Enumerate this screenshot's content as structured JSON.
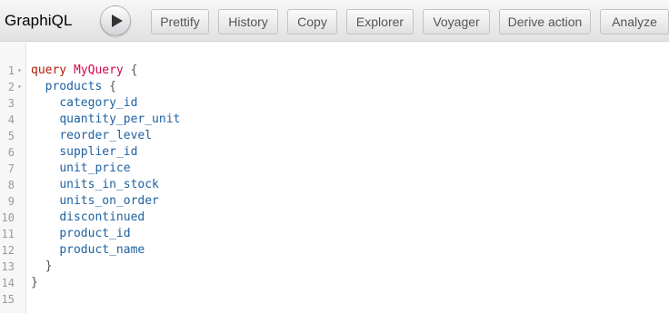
{
  "toolbar": {
    "title": "GraphiQL",
    "buttons": [
      "Prettify",
      "History",
      "Copy",
      "Explorer",
      "Voyager",
      "Derive action",
      "Analyze"
    ]
  },
  "editor": {
    "lines": [
      {
        "num": "1",
        "fold": true,
        "indent": "",
        "tokens": [
          {
            "t": "query",
            "c": "kw"
          },
          {
            "t": " ",
            "c": "punct"
          },
          {
            "t": "MyQuery",
            "c": "def"
          },
          {
            "t": " {",
            "c": "punct"
          }
        ]
      },
      {
        "num": "2",
        "fold": true,
        "indent": "  ",
        "tokens": [
          {
            "t": "products",
            "c": "field"
          },
          {
            "t": " {",
            "c": "punct"
          }
        ]
      },
      {
        "num": "3",
        "fold": false,
        "indent": "    ",
        "tokens": [
          {
            "t": "category_id",
            "c": "field"
          }
        ]
      },
      {
        "num": "4",
        "fold": false,
        "indent": "    ",
        "tokens": [
          {
            "t": "quantity_per_unit",
            "c": "field"
          }
        ]
      },
      {
        "num": "5",
        "fold": false,
        "indent": "    ",
        "tokens": [
          {
            "t": "reorder_level",
            "c": "field"
          }
        ]
      },
      {
        "num": "6",
        "fold": false,
        "indent": "    ",
        "tokens": [
          {
            "t": "supplier_id",
            "c": "field"
          }
        ]
      },
      {
        "num": "7",
        "fold": false,
        "indent": "    ",
        "tokens": [
          {
            "t": "unit_price",
            "c": "field"
          }
        ]
      },
      {
        "num": "8",
        "fold": false,
        "indent": "    ",
        "tokens": [
          {
            "t": "units_in_stock",
            "c": "field"
          }
        ]
      },
      {
        "num": "9",
        "fold": false,
        "indent": "    ",
        "tokens": [
          {
            "t": "units_on_order",
            "c": "field"
          }
        ]
      },
      {
        "num": "10",
        "fold": false,
        "indent": "    ",
        "tokens": [
          {
            "t": "discontinued",
            "c": "field"
          }
        ]
      },
      {
        "num": "11",
        "fold": false,
        "indent": "    ",
        "tokens": [
          {
            "t": "product_id",
            "c": "field"
          }
        ]
      },
      {
        "num": "12",
        "fold": false,
        "indent": "    ",
        "tokens": [
          {
            "t": "product_name",
            "c": "field"
          }
        ]
      },
      {
        "num": "13",
        "fold": false,
        "indent": "  ",
        "tokens": [
          {
            "t": "}",
            "c": "punct"
          }
        ]
      },
      {
        "num": "14",
        "fold": false,
        "indent": "",
        "tokens": [
          {
            "t": "}",
            "c": "punct"
          }
        ]
      },
      {
        "num": "15",
        "fold": false,
        "indent": "",
        "tokens": []
      }
    ]
  },
  "colors": {
    "keyword": "#b11a04",
    "definition": "#d2054e",
    "field": "#1f61a0",
    "punctuation": "#555555"
  }
}
